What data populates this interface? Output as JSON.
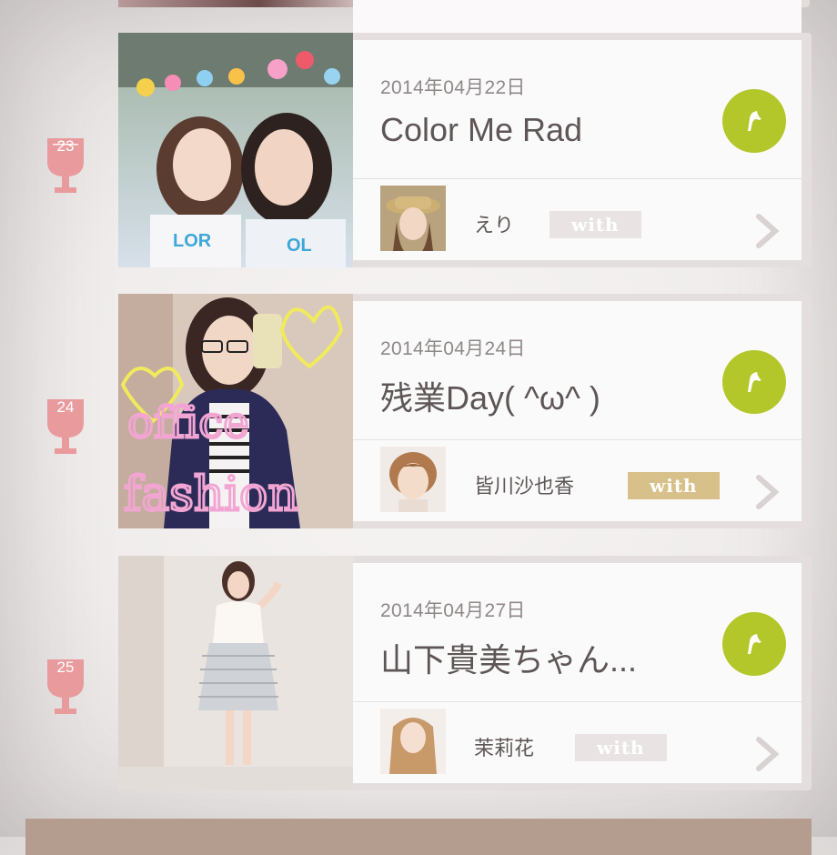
{
  "colors": {
    "accent_green": "#b3c72a",
    "rank_pink": "#e99a9c",
    "with_gold": "#d8c08a",
    "with_grey": "#e9e4e3"
  },
  "entries": [
    {
      "rank": "23",
      "date": "2014年04月22日",
      "title": "Color Me Rad",
      "user": "えり",
      "with_label": "with",
      "icons": {
        "rank": "trophy-cup-icon",
        "badge": "high-heel-icon",
        "more": "chevron-right-icon"
      }
    },
    {
      "rank": "24",
      "date": "2014年04月24日",
      "title": "残業Day( ^ω^ )",
      "user": "皆川沙也香",
      "with_label": "with",
      "photo_doodle": "office fashion",
      "icons": {
        "rank": "trophy-cup-icon",
        "badge": "high-heel-icon",
        "more": "chevron-right-icon"
      }
    },
    {
      "rank": "25",
      "date": "2014年04月27日",
      "title": "山下貴美ちゃん...",
      "user": "茉莉花",
      "with_label": "with",
      "icons": {
        "rank": "trophy-cup-icon",
        "badge": "high-heel-icon",
        "more": "chevron-right-icon"
      }
    }
  ]
}
